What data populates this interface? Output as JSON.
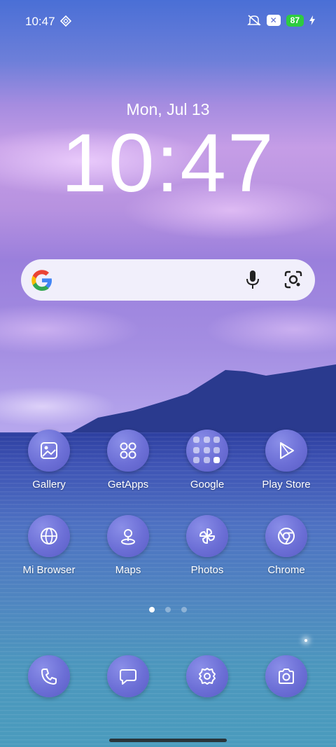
{
  "status_bar": {
    "time": "10:47",
    "battery": "87",
    "icons": [
      "location-diamond-icon",
      "mute-icon",
      "close-badge-icon",
      "charging-bolt-icon"
    ]
  },
  "lockscreen": {
    "date": "Mon, Jul 13",
    "time": "10:47"
  },
  "search_bar": {
    "icons": [
      "google-logo-icon",
      "microphone-icon",
      "camera-lens-icon"
    ]
  },
  "apps_row1": [
    {
      "label": "Gallery",
      "icon": "gallery-icon"
    },
    {
      "label": "GetApps",
      "icon": "grid-icon"
    },
    {
      "label": "Google",
      "icon": "folder-icon"
    },
    {
      "label": "Play Store",
      "icon": "play-icon"
    }
  ],
  "apps_row2": [
    {
      "label": "Mi Browser",
      "icon": "globe-icon"
    },
    {
      "label": "Maps",
      "icon": "map-pin-icon"
    },
    {
      "label": "Photos",
      "icon": "pinwheel-icon"
    },
    {
      "label": "Chrome",
      "icon": "chrome-icon"
    }
  ],
  "dock": [
    {
      "icon": "phone-icon"
    },
    {
      "icon": "messages-icon"
    },
    {
      "icon": "settings-icon"
    },
    {
      "icon": "camera-icon"
    }
  ],
  "page_indicator": {
    "count": 3,
    "active": 1
  },
  "colors": {
    "icon_bg": "#6c6fd6",
    "battery": "#2ecc40"
  }
}
